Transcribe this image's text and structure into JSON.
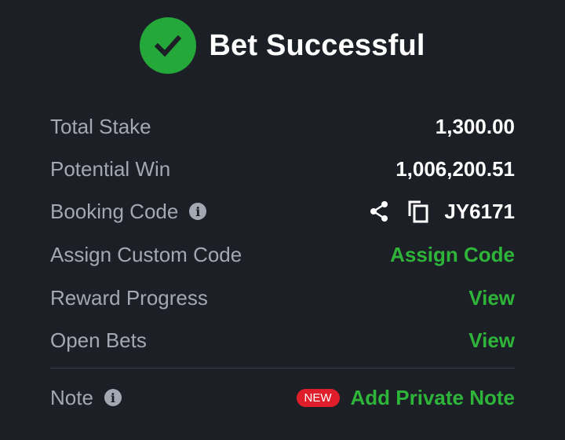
{
  "header": {
    "title": "Bet Successful",
    "icon": "check-circle-icon",
    "icon_color": "#24a83a"
  },
  "rows": {
    "total_stake": {
      "label": "Total Stake",
      "value": "1,300.00"
    },
    "potential_win": {
      "label": "Potential Win",
      "value": "1,006,200.51"
    },
    "booking_code": {
      "label": "Booking Code",
      "value": "JY6171"
    },
    "assign_custom_code": {
      "label": "Assign Custom Code",
      "action": "Assign Code"
    },
    "reward_progress": {
      "label": "Reward Progress",
      "action": "View"
    },
    "open_bets": {
      "label": "Open Bets",
      "action": "View"
    },
    "note": {
      "label": "Note",
      "badge": "NEW",
      "action": "Add Private Note"
    }
  },
  "colors": {
    "background": "#1c1f26",
    "accent_green": "#2fb43a",
    "badge_red": "#e01e2b",
    "label_gray": "#a3a8b3"
  }
}
